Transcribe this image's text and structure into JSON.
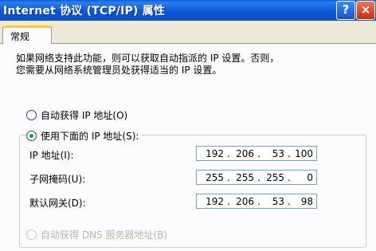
{
  "window": {
    "title": "Internet 协议 (TCP/IP) 属性",
    "help_glyph": "?",
    "close_glyph": "×"
  },
  "tabs": [
    {
      "label": "常规"
    }
  ],
  "description": "如果网络支持此功能，则可以获取自动指派的 IP 设置。否则，\n您需要从网络系统管理员处获得适当的 IP 设置。",
  "ip_mode": {
    "auto_label": "自动获得 IP 地址(O)",
    "manual_label": "使用下面的 IP 地址(S):",
    "selected": "manual"
  },
  "fields": {
    "ip": {
      "label": "IP 地址(I):",
      "octets": [
        "192",
        "206",
        "53",
        "100"
      ]
    },
    "mask": {
      "label": "子网掩码(U):",
      "octets": [
        "255",
        "255",
        "255",
        "0"
      ]
    },
    "gateway": {
      "label": "默认网关(D):",
      "octets": [
        "192",
        "206",
        "53",
        "98"
      ]
    }
  },
  "dns_auto_partial": "自动获得 DNS 服务器地址(B)"
}
